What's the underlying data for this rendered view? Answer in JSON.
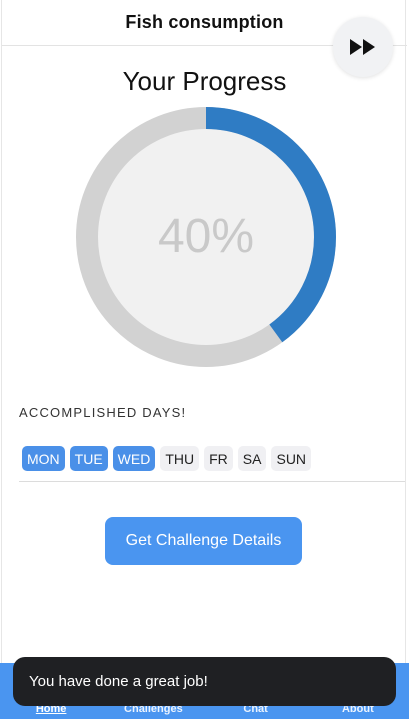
{
  "header": {
    "title": "Fish consumption",
    "skip_icon": "fast-forward-icon"
  },
  "progress": {
    "heading": "Your Progress",
    "percent_label": "40%",
    "value": 0.4,
    "fill_color": "#2f7cc4",
    "track_color": "#d2d2d2"
  },
  "days": {
    "label": "ACCOMPLISHED DAYS!",
    "items": [
      {
        "label": "MON",
        "done": true
      },
      {
        "label": "TUE",
        "done": true
      },
      {
        "label": "WED",
        "done": true
      },
      {
        "label": "THU",
        "done": false
      },
      {
        "label": "FR",
        "done": false
      },
      {
        "label": "SA",
        "done": false
      },
      {
        "label": "SUN",
        "done": false
      }
    ]
  },
  "cta": {
    "label": "Get Challenge Details"
  },
  "tabs": [
    {
      "label": "Home",
      "active": true
    },
    {
      "label": "Challenges",
      "active": false
    },
    {
      "label": "Chat",
      "active": false
    },
    {
      "label": "About",
      "active": false
    }
  ],
  "toast": {
    "message": "You have done a great job!"
  },
  "colors": {
    "accent": "#4a95f0",
    "toast_bg": "#1f2023"
  }
}
